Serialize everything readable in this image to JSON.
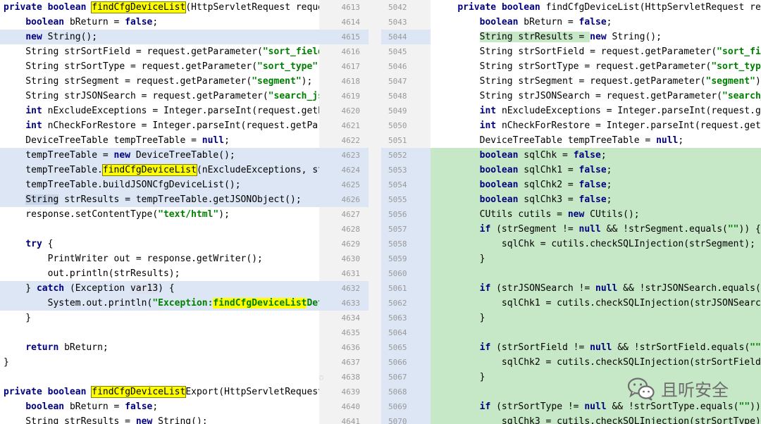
{
  "left": {
    "lines": [
      {
        "bg": "none",
        "segs": [
          [
            "kw",
            "private "
          ],
          [
            "kw",
            "boolean "
          ],
          [
            "hl",
            "findCfgDeviceList"
          ],
          [
            "",
            "(HttpServletRequest request"
          ]
        ]
      },
      {
        "bg": "none",
        "segs": [
          [
            "",
            "    "
          ],
          [
            "kw",
            "boolean "
          ],
          [
            "",
            "bReturn = "
          ],
          [
            "kw",
            "false"
          ],
          [
            "",
            ";"
          ]
        ]
      },
      {
        "bg": "changed",
        "segs": [
          [
            "",
            "    "
          ],
          [
            "kw",
            "new "
          ],
          [
            "",
            "String();"
          ]
        ]
      },
      {
        "bg": "none",
        "segs": [
          [
            "",
            "    String strSortField = request.getParameter("
          ],
          [
            "str",
            "\"sort_field\""
          ],
          [
            "",
            ")"
          ]
        ]
      },
      {
        "bg": "none",
        "segs": [
          [
            "",
            "    String strSortType = request.getParameter("
          ],
          [
            "str",
            "\"sort_type\""
          ],
          [
            "",
            ");"
          ]
        ]
      },
      {
        "bg": "none",
        "segs": [
          [
            "",
            "    String strSegment = request.getParameter("
          ],
          [
            "str",
            "\"segment\""
          ],
          [
            "",
            ");"
          ]
        ]
      },
      {
        "bg": "none",
        "segs": [
          [
            "",
            "    String strJSONSearch = request.getParameter("
          ],
          [
            "str",
            "\"search_json"
          ]
        ]
      },
      {
        "bg": "none",
        "segs": [
          [
            "",
            "    "
          ],
          [
            "kw",
            "int "
          ],
          [
            "",
            "nExcludeExceptions = Integer.parseInt(request.getPar"
          ]
        ]
      },
      {
        "bg": "none",
        "segs": [
          [
            "",
            "    "
          ],
          [
            "kw",
            "int "
          ],
          [
            "",
            "nCheckForRestore = Integer.parseInt(request.getParam"
          ]
        ]
      },
      {
        "bg": "none",
        "segs": [
          [
            "",
            "    DeviceTreeTable tempTreeTable = "
          ],
          [
            "kw",
            "null"
          ],
          [
            "",
            ";"
          ]
        ]
      },
      {
        "bg": "changed",
        "segs": [
          [
            "",
            "    tempTreeTable = "
          ],
          [
            "kw",
            "new "
          ],
          [
            "",
            "DeviceTreeTable();"
          ]
        ]
      },
      {
        "bg": "changed",
        "segs": [
          [
            "",
            "    tempTreeTable."
          ],
          [
            "hl",
            "findCfgDeviceList"
          ],
          [
            "",
            "(nExcludeExceptions, strS"
          ]
        ]
      },
      {
        "bg": "changed",
        "segs": [
          [
            "",
            "    tempTreeTable.buildJSONCfgDeviceList();"
          ]
        ]
      },
      {
        "bg": "changed",
        "segs": [
          [
            "",
            "    "
          ],
          [
            "sel",
            "String"
          ],
          [
            "",
            " strResults = tempTreeTable.getJSONObject();"
          ]
        ]
      },
      {
        "bg": "none",
        "segs": [
          [
            "",
            "    response.setContentType("
          ],
          [
            "str",
            "\"text/html\""
          ],
          [
            "",
            ");"
          ]
        ]
      },
      {
        "bg": "none",
        "segs": [
          [
            "",
            ""
          ]
        ]
      },
      {
        "bg": "none",
        "segs": [
          [
            "",
            "    "
          ],
          [
            "kw",
            "try "
          ],
          [
            "",
            "{"
          ]
        ]
      },
      {
        "bg": "none",
        "segs": [
          [
            "",
            "        PrintWriter out = response.getWriter();"
          ]
        ]
      },
      {
        "bg": "none",
        "segs": [
          [
            "",
            "        out.println(strResults);"
          ]
        ]
      },
      {
        "bg": "changed",
        "segs": [
          [
            "",
            "    } "
          ],
          [
            "kw",
            "catch "
          ],
          [
            "",
            "(Exception "
          ],
          [
            "var",
            "var13"
          ],
          [
            "",
            ") {"
          ]
        ]
      },
      {
        "bg": "changed",
        "segs": [
          [
            "",
            "        System.out.println("
          ],
          [
            "str",
            "\"Exception:"
          ],
          [
            "hlstr",
            "findCfgDeviceList"
          ],
          [
            "str",
            "Detai"
          ]
        ]
      },
      {
        "bg": "none",
        "segs": [
          [
            "",
            "    }"
          ]
        ]
      },
      {
        "bg": "none",
        "segs": [
          [
            "",
            ""
          ]
        ]
      },
      {
        "bg": "none",
        "segs": [
          [
            "",
            "    "
          ],
          [
            "kw",
            "return "
          ],
          [
            "",
            "bReturn;"
          ]
        ]
      },
      {
        "bg": "none",
        "segs": [
          [
            "",
            "}"
          ]
        ]
      },
      {
        "bg": "none",
        "segs": [
          [
            "",
            ""
          ]
        ]
      },
      {
        "bg": "none",
        "segs": [
          [
            "kw",
            "private "
          ],
          [
            "kw",
            "boolean "
          ],
          [
            "hl",
            "findCfgDeviceList"
          ],
          [
            "",
            "Export(HttpServletRequest r"
          ]
        ]
      },
      {
        "bg": "none",
        "segs": [
          [
            "",
            "    "
          ],
          [
            "kw",
            "boolean "
          ],
          [
            "",
            "bReturn = "
          ],
          [
            "kw",
            "false"
          ],
          [
            "",
            ";"
          ]
        ]
      },
      {
        "bg": "none",
        "segs": [
          [
            "",
            "    String strResults = "
          ],
          [
            "kw",
            "new "
          ],
          [
            "",
            "String();"
          ]
        ]
      }
    ]
  },
  "gutter": {
    "lines": [
      {
        "l": "4613",
        "r": "5042",
        "lbg": "none",
        "rbg": "none"
      },
      {
        "l": "4614",
        "r": "5043",
        "lbg": "none",
        "rbg": "none"
      },
      {
        "l": "4615",
        "r": "5044",
        "lbg": "changed",
        "rbg": "changed"
      },
      {
        "l": "4616",
        "r": "5045",
        "lbg": "none",
        "rbg": "none"
      },
      {
        "l": "4617",
        "r": "5046",
        "lbg": "none",
        "rbg": "none"
      },
      {
        "l": "4618",
        "r": "5047",
        "lbg": "none",
        "rbg": "none"
      },
      {
        "l": "4619",
        "r": "5048",
        "lbg": "none",
        "rbg": "none"
      },
      {
        "l": "4620",
        "r": "5049",
        "lbg": "none",
        "rbg": "none"
      },
      {
        "l": "4621",
        "r": "5050",
        "lbg": "none",
        "rbg": "none"
      },
      {
        "l": "4622",
        "r": "5051",
        "lbg": "none",
        "rbg": "none"
      },
      {
        "l": "4623",
        "r": "5052",
        "lbg": "changed",
        "rbg": "changed"
      },
      {
        "l": "4624",
        "r": "5053",
        "lbg": "changed",
        "rbg": "changed"
      },
      {
        "l": "4625",
        "r": "5054",
        "lbg": "changed",
        "rbg": "changed"
      },
      {
        "l": "4626",
        "r": "5055",
        "lbg": "changed",
        "rbg": "changed"
      },
      {
        "l": "4627",
        "r": "5056",
        "lbg": "none",
        "rbg": "changed"
      },
      {
        "l": "4628",
        "r": "5057",
        "lbg": "none",
        "rbg": "changed"
      },
      {
        "l": "4629",
        "r": "5058",
        "lbg": "none",
        "rbg": "changed"
      },
      {
        "l": "4630",
        "r": "5059",
        "lbg": "none",
        "rbg": "changed"
      },
      {
        "l": "4631",
        "r": "5060",
        "lbg": "none",
        "rbg": "changed"
      },
      {
        "l": "4632",
        "r": "5061",
        "lbg": "changed",
        "rbg": "changed"
      },
      {
        "l": "4633",
        "r": "5062",
        "lbg": "changed",
        "rbg": "changed"
      },
      {
        "l": "4634",
        "r": "5063",
        "lbg": "none",
        "rbg": "changed"
      },
      {
        "l": "4635",
        "r": "5064",
        "lbg": "none",
        "rbg": "changed"
      },
      {
        "l": "4636",
        "r": "5065",
        "lbg": "none",
        "rbg": "changed"
      },
      {
        "l": "4637",
        "r": "5066",
        "lbg": "none",
        "rbg": "changed"
      },
      {
        "l": "4638",
        "r": "5067",
        "lbg": "none",
        "rbg": "changed"
      },
      {
        "l": "4639",
        "r": "5068",
        "lbg": "none",
        "rbg": "changed"
      },
      {
        "l": "4640",
        "r": "5069",
        "lbg": "none",
        "rbg": "changed"
      },
      {
        "l": "4641",
        "r": "5070",
        "lbg": "none",
        "rbg": "changed"
      }
    ]
  },
  "right": {
    "lines": [
      {
        "bg": "none",
        "segs": [
          [
            "",
            "    "
          ],
          [
            "kw",
            "private "
          ],
          [
            "kw",
            "boolean "
          ],
          [
            "",
            "findCfgDeviceList(HttpServletRequest reques"
          ]
        ]
      },
      {
        "bg": "none",
        "segs": [
          [
            "",
            "        "
          ],
          [
            "kw",
            "boolean "
          ],
          [
            "",
            "bReturn = "
          ],
          [
            "kw",
            "false"
          ],
          [
            "",
            ";"
          ]
        ]
      },
      {
        "bg": "none",
        "segs": [
          [
            "",
            "        "
          ],
          [
            "add",
            "String strResults = "
          ],
          [
            "kw",
            "new "
          ],
          [
            "",
            "String();"
          ]
        ]
      },
      {
        "bg": "none",
        "segs": [
          [
            "",
            "        String strSortField = request.getParameter("
          ],
          [
            "str",
            "\"sort_field\""
          ]
        ]
      },
      {
        "bg": "none",
        "segs": [
          [
            "",
            "        String strSortType = request.getParameter("
          ],
          [
            "str",
            "\"sort_type\""
          ],
          [
            "",
            ");"
          ]
        ]
      },
      {
        "bg": "none",
        "segs": [
          [
            "",
            "        String strSegment = request.getParameter("
          ],
          [
            "str",
            "\"segment\""
          ],
          [
            "",
            ");"
          ]
        ]
      },
      {
        "bg": "none",
        "segs": [
          [
            "",
            "        String strJSONSearch = request.getParameter("
          ],
          [
            "str",
            "\"search_jso"
          ]
        ]
      },
      {
        "bg": "none",
        "segs": [
          [
            "",
            "        "
          ],
          [
            "kw",
            "int "
          ],
          [
            "",
            "nExcludeExceptions = Integer.parseInt(request.getPa"
          ]
        ]
      },
      {
        "bg": "none",
        "segs": [
          [
            "",
            "        "
          ],
          [
            "kw",
            "int "
          ],
          [
            "",
            "nCheckForRestore = Integer.parseInt(request.getPara"
          ]
        ]
      },
      {
        "bg": "none",
        "segs": [
          [
            "",
            "        DeviceTreeTable tempTreeTable = "
          ],
          [
            "kw",
            "null"
          ],
          [
            "",
            ";"
          ]
        ]
      },
      {
        "bg": "added",
        "segs": [
          [
            "",
            "        "
          ],
          [
            "kw",
            "boolean "
          ],
          [
            "",
            "sqlChk = "
          ],
          [
            "kw",
            "false"
          ],
          [
            "",
            ";"
          ]
        ]
      },
      {
        "bg": "added",
        "segs": [
          [
            "",
            "        "
          ],
          [
            "kw",
            "boolean "
          ],
          [
            "",
            "sqlChk1 = "
          ],
          [
            "kw",
            "false"
          ],
          [
            "",
            ";"
          ]
        ]
      },
      {
        "bg": "added",
        "segs": [
          [
            "",
            "        "
          ],
          [
            "kw",
            "boolean "
          ],
          [
            "",
            "sqlChk2 = "
          ],
          [
            "kw",
            "false"
          ],
          [
            "",
            ";"
          ]
        ]
      },
      {
        "bg": "added",
        "segs": [
          [
            "",
            "        "
          ],
          [
            "kw",
            "boolean "
          ],
          [
            "",
            "sqlChk3 = "
          ],
          [
            "kw",
            "false"
          ],
          [
            "",
            ";"
          ]
        ]
      },
      {
        "bg": "added",
        "segs": [
          [
            "",
            "        CUtils cutils = "
          ],
          [
            "kw",
            "new "
          ],
          [
            "",
            "CUtils();"
          ]
        ]
      },
      {
        "bg": "added",
        "segs": [
          [
            "",
            "        "
          ],
          [
            "kw",
            "if "
          ],
          [
            "",
            "(strSegment != "
          ],
          [
            "kw",
            "null "
          ],
          [
            "",
            "&& !strSegment.equals("
          ],
          [
            "str",
            "\"\""
          ],
          [
            "",
            ")) {"
          ]
        ]
      },
      {
        "bg": "added",
        "segs": [
          [
            "",
            "            sqlChk = cutils.checkSQLInjection(strSegment);"
          ]
        ]
      },
      {
        "bg": "added",
        "segs": [
          [
            "",
            "        }"
          ]
        ]
      },
      {
        "bg": "added",
        "segs": [
          [
            "",
            ""
          ]
        ]
      },
      {
        "bg": "added",
        "segs": [
          [
            "",
            "        "
          ],
          [
            "kw",
            "if "
          ],
          [
            "",
            "(strJSONSearch != "
          ],
          [
            "kw",
            "null "
          ],
          [
            "",
            "&& !strJSONSearch.equals("
          ],
          [
            "str",
            "\"\""
          ],
          [
            "",
            "))"
          ]
        ]
      },
      {
        "bg": "added",
        "segs": [
          [
            "",
            "            sqlChk1 = cutils.checkSQLInjection(strJSONSearch);"
          ]
        ]
      },
      {
        "bg": "added",
        "segs": [
          [
            "",
            "        }"
          ]
        ]
      },
      {
        "bg": "added",
        "segs": [
          [
            "",
            ""
          ]
        ]
      },
      {
        "bg": "added",
        "segs": [
          [
            "",
            "        "
          ],
          [
            "kw",
            "if "
          ],
          [
            "",
            "(strSortField != "
          ],
          [
            "kw",
            "null "
          ],
          [
            "",
            "&& !strSortField.equals("
          ],
          [
            "str",
            "\"\""
          ],
          [
            "",
            "))  {"
          ]
        ]
      },
      {
        "bg": "added",
        "segs": [
          [
            "",
            "            sqlChk2 = cutils.checkSQLInjection(strSortField);"
          ]
        ]
      },
      {
        "bg": "added",
        "segs": [
          [
            "",
            "        }"
          ]
        ]
      },
      {
        "bg": "added",
        "segs": [
          [
            "",
            ""
          ]
        ]
      },
      {
        "bg": "added",
        "segs": [
          [
            "",
            "        "
          ],
          [
            "kw",
            "if "
          ],
          [
            "",
            "(strSortType != "
          ],
          [
            "kw",
            "null "
          ],
          [
            "",
            "&& !strSortType.equals("
          ],
          [
            "str",
            "\"\""
          ],
          [
            "",
            ")) {"
          ]
        ]
      },
      {
        "bg": "added",
        "segs": [
          [
            "",
            "            sqlChk3 = cutils.checkSQLInjection(strSortType);"
          ]
        ]
      }
    ]
  },
  "watermark": {
    "text": "且听安全",
    "icon": "wechat-icon"
  },
  "colors": {
    "changed": "#dce6f5",
    "added": "#c6e8c6",
    "highlight": "#ffff00",
    "keyword": "#000080",
    "string": "#008000"
  }
}
